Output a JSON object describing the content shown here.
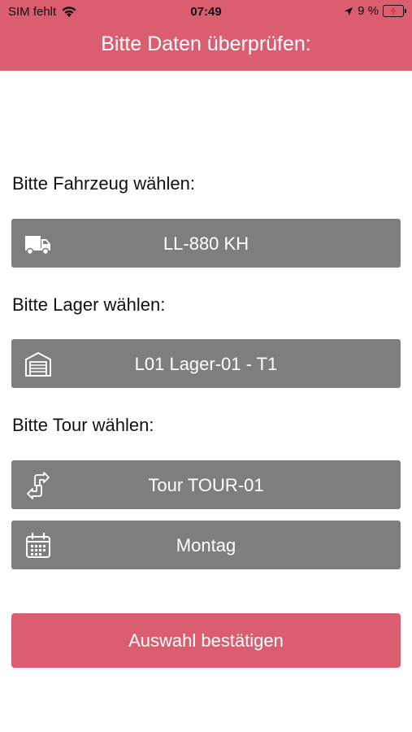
{
  "status_bar": {
    "carrier": "SIM fehlt",
    "time": "07:49",
    "battery": "9 %"
  },
  "header": {
    "title": "Bitte Daten überprüfen:"
  },
  "vehicle": {
    "label": "Bitte Fahrzeug wählen:",
    "value": "LL-880 KH",
    "icon": "truck-icon"
  },
  "warehouse": {
    "label": "Bitte Lager wählen:",
    "value": "L01 Lager-01 - T1",
    "icon": "warehouse-icon"
  },
  "tour": {
    "label": "Bitte Tour wählen:",
    "value": "Tour TOUR-01",
    "icon": "route-arrows-icon"
  },
  "day": {
    "value": "Montag",
    "icon": "calendar-icon"
  },
  "confirm_button": {
    "label": "Auswahl bestätigen"
  },
  "colors": {
    "accent": "#da5d70",
    "field_bg": "#7e7e7e"
  }
}
